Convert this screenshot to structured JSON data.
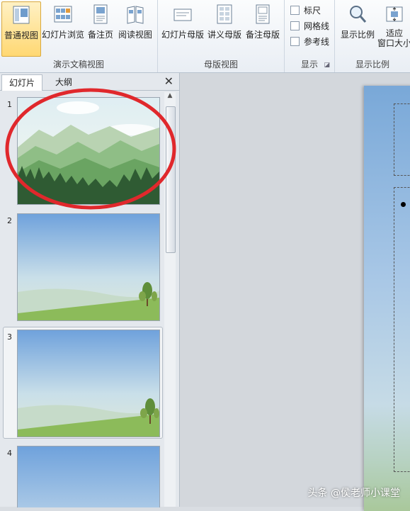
{
  "ribbon": {
    "presentation_views": {
      "label": "演示文稿视图",
      "buttons": [
        "普通视图",
        "幻灯片浏览",
        "备注页",
        "阅读视图"
      ]
    },
    "master_views": {
      "label": "母版视图",
      "buttons": [
        "幻灯片母版",
        "讲义母版",
        "备注母版"
      ]
    },
    "show": {
      "label": "显示",
      "checkboxes": [
        "标尺",
        "网格线",
        "参考线"
      ]
    },
    "zoom": {
      "label": "显示比例",
      "zoom_button": "显示比例",
      "fit_button_line1": "适应",
      "fit_button_line2": "窗口大小"
    }
  },
  "panel": {
    "tabs": [
      "幻灯片",
      "大纲"
    ],
    "close": "✕",
    "slides": [
      "1",
      "2",
      "3",
      "4"
    ]
  },
  "watermark": "头条 @侯老师小课堂",
  "colors": {
    "accent_highlight": "#ffd873",
    "annotation_circle": "#e0282c"
  }
}
